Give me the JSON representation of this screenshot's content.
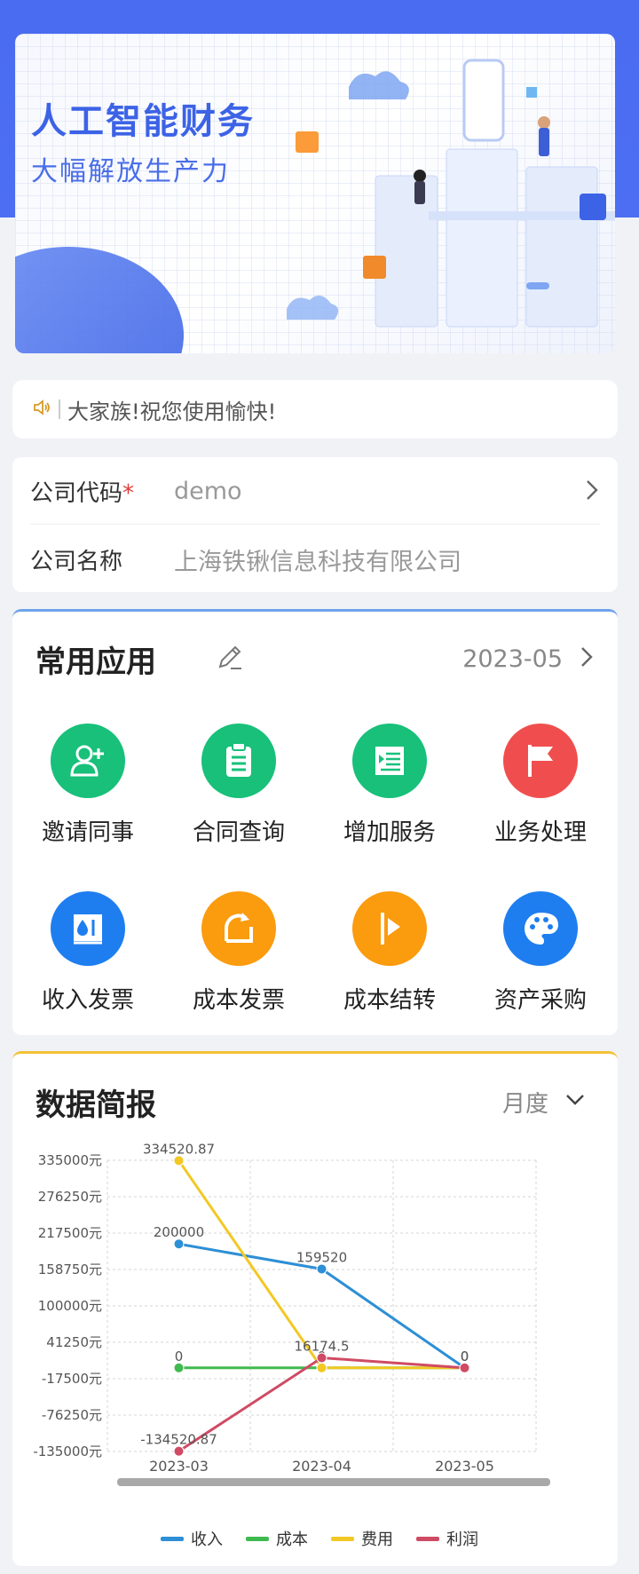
{
  "banner": {
    "title": "人工智能财务",
    "subtitle": "大幅解放生产力"
  },
  "notice": {
    "icon": "speaker-icon",
    "text": "大家族!祝您使用愉快!"
  },
  "company": {
    "code_label": "公司代码",
    "required_mark": "*",
    "code_value": "demo",
    "name_label": "公司名称",
    "name_value": "上海铁锹信息科技有限公司"
  },
  "apps": {
    "title": "常用应用",
    "period": "2023-05",
    "items": [
      {
        "label": "邀请同事",
        "icon": "add-user-icon",
        "color": "#18c07a"
      },
      {
        "label": "合同查询",
        "icon": "clipboard-icon",
        "color": "#18c07a"
      },
      {
        "label": "增加服务",
        "icon": "list-indent-icon",
        "color": "#18c07a"
      },
      {
        "label": "业务处理",
        "icon": "flag-icon",
        "color": "#f04e4e"
      },
      {
        "label": "收入发票",
        "icon": "invoice-icon",
        "color": "#1e7ef0"
      },
      {
        "label": "成本发票",
        "icon": "cost-invoice-icon",
        "color": "#fb9b0e"
      },
      {
        "label": "成本结转",
        "icon": "carry-over-icon",
        "color": "#fb9b0e"
      },
      {
        "label": "资产采购",
        "icon": "palette-icon",
        "color": "#1e7ef0"
      }
    ]
  },
  "report": {
    "title": "数据简报",
    "period": "月度"
  },
  "chart_data": {
    "type": "line",
    "x": [
      "2023-03",
      "2023-04",
      "2023-05"
    ],
    "y_unit": "元",
    "y_ticks": [
      335000,
      276250,
      217500,
      158750,
      100000,
      41250,
      -17500,
      -76250,
      -135000
    ],
    "ylim": [
      -135000,
      335000
    ],
    "grid": true,
    "legend_position": "bottom",
    "series": [
      {
        "name": "收入",
        "color": "#2d8fd5",
        "values": [
          200000,
          159520,
          0
        ],
        "labels": [
          "200000",
          "159520",
          "0"
        ]
      },
      {
        "name": "成本",
        "color": "#3fba4f",
        "values": [
          0,
          0,
          0
        ],
        "labels": [
          "0",
          "",
          ""
        ]
      },
      {
        "name": "费用",
        "color": "#f2c824",
        "values": [
          334520.87,
          0,
          0
        ],
        "labels": [
          "334520.87",
          "0",
          ""
        ]
      },
      {
        "name": "利润",
        "color": "#cf4b63",
        "values": [
          -134520.87,
          16174.5,
          0
        ],
        "labels": [
          "-134520.87",
          "16174.5",
          "0"
        ]
      }
    ]
  }
}
